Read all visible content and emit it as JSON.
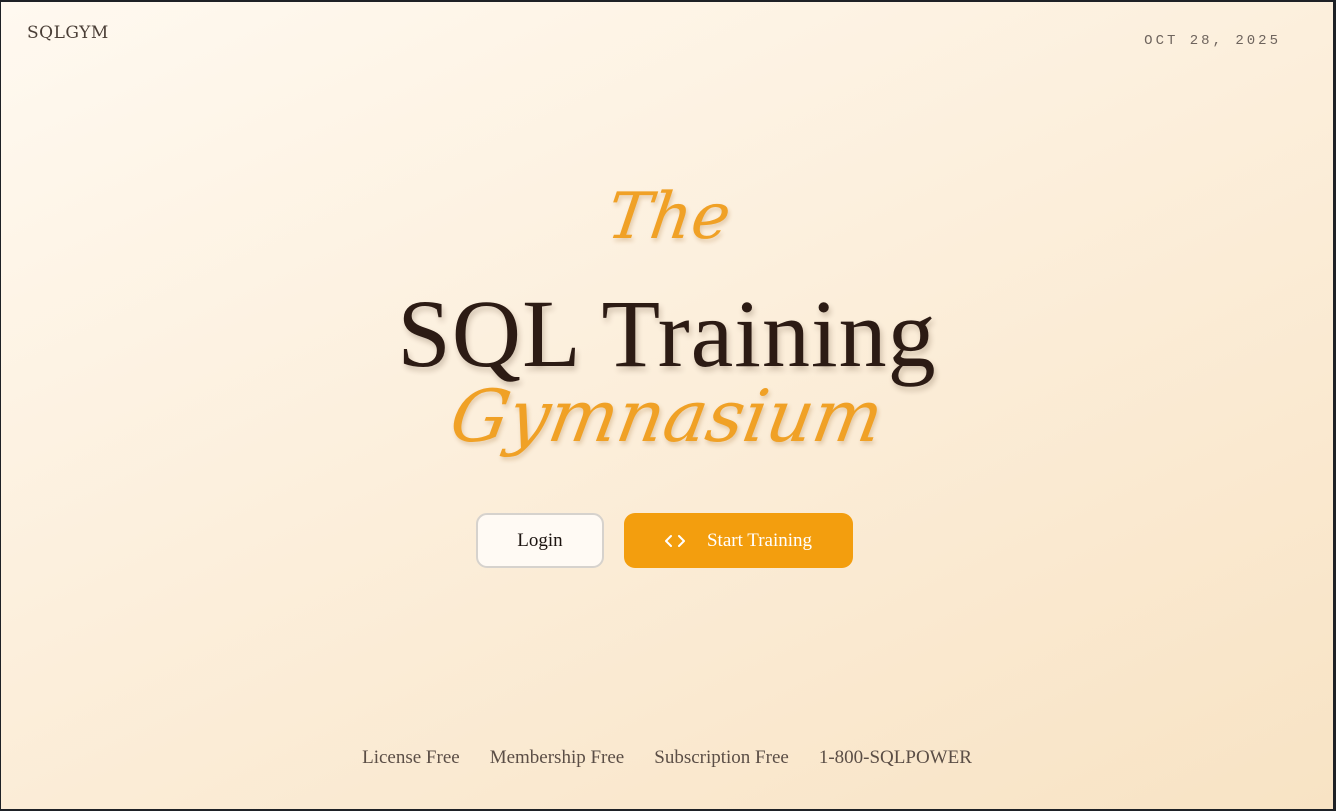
{
  "header": {
    "brand": "SQLGYM",
    "date": "OCT 28, 2025"
  },
  "hero": {
    "the": "The",
    "title": "SQL Training",
    "subtitle": "Gymnasium"
  },
  "actions": {
    "login_label": "Login",
    "start_label": "Start Training",
    "start_icon": "code-brackets-icon"
  },
  "footer": {
    "items": [
      "License Free",
      "Membership Free",
      "Subscription Free",
      "1-800-SQLPOWER"
    ]
  },
  "colors": {
    "accent": "#f39e0e",
    "title": "#2c1b14",
    "script": "#f0a126"
  }
}
